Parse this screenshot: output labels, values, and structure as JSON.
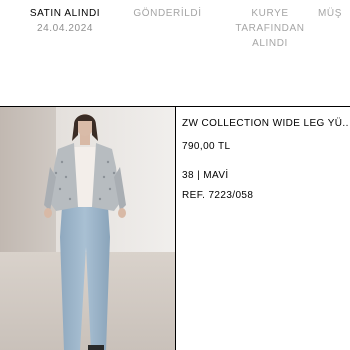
{
  "order_status": {
    "steps": [
      {
        "label": "SATIN ALINDI",
        "date": "24.04.2024",
        "state": "done"
      },
      {
        "label": "GÖNDERİLDİ",
        "date": "",
        "state": "pending"
      },
      {
        "label": "KURYE TARAFINDAN ALINDI",
        "date": "",
        "state": "pending"
      },
      {
        "label": "MÜŞ",
        "date": "",
        "state": "pending"
      }
    ]
  },
  "product": {
    "name": "ZW COLLECTION WIDE LEG YÜ...",
    "price": "790,00 TL",
    "variant": "38 | MAVİ",
    "reference": "REF. 7223/058",
    "image_icon": "product-photo"
  },
  "colors": {
    "text": "#000000",
    "muted": "#a5a5a5",
    "background": "#ffffff"
  }
}
